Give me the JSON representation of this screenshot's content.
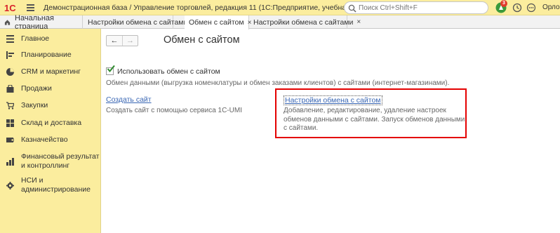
{
  "titlebar": {
    "app_title": "Демонстрационная база / Управление торговлей, редакция 11  (1С:Предприятие, учебная версия)",
    "search_placeholder": "Поиск Ctrl+Shift+F",
    "notification_count": "3",
    "user_name": "Орлов"
  },
  "tabs": {
    "home": "Начальная страница",
    "items": [
      {
        "label": "Настройки обмена с сайтами"
      },
      {
        "label": "Обмен с сайтом"
      },
      {
        "label": "Настройки обмена с сайтами"
      }
    ],
    "close_glyph": "×"
  },
  "sidebar": {
    "items": [
      {
        "label": "Главное"
      },
      {
        "label": "Планирование"
      },
      {
        "label": "CRM и маркетинг"
      },
      {
        "label": "Продажи"
      },
      {
        "label": "Закупки"
      },
      {
        "label": "Склад и доставка"
      },
      {
        "label": "Казначейство"
      },
      {
        "label": "Финансовый результат и контроллинг"
      },
      {
        "label": "НСИ и администрирование"
      }
    ]
  },
  "main": {
    "back": "←",
    "forward": "→",
    "title": "Обмен с сайтом",
    "use_exchange_label": "Использовать обмен с сайтом",
    "use_exchange_checked": true,
    "use_exchange_desc": "Обмен данными (выгрузка номенклатуры и обмен заказами клиентов) с сайтами (интернет-магазинами).",
    "create_site_link": "Создать сайт",
    "create_site_desc": "Создать сайт с помощью сервиса 1С-UMI",
    "settings_link": "Настройки обмена с сайтом",
    "settings_desc": "Добавление, редактирование, удаление настроек обменов данными с сайтами. Запуск обменов данными с сайтами."
  },
  "colors": {
    "panel_yellow": "#fbed9e",
    "link_blue": "#3a67b4",
    "highlight_red": "#e40000"
  }
}
